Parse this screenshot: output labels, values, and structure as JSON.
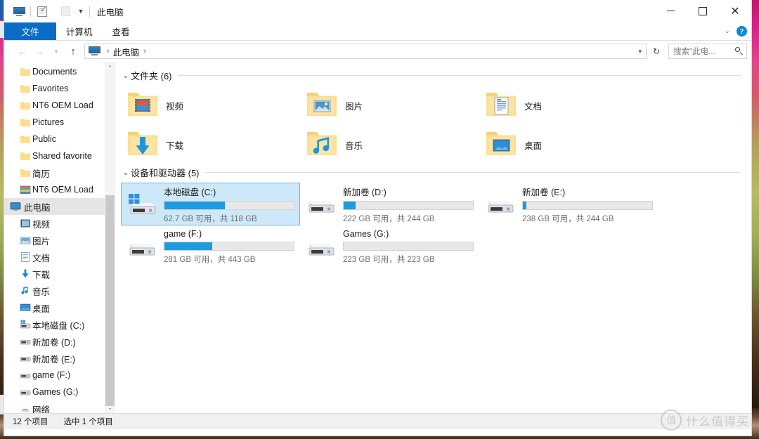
{
  "window": {
    "title": "此电脑",
    "quick_access": [
      "monitor-icon",
      "properties-icon",
      "blank-icon"
    ],
    "controls": {
      "minimize": "—",
      "maximize": "□",
      "close": "✕"
    }
  },
  "ribbon": {
    "tabs": [
      {
        "label": "文件",
        "active_file": true
      },
      {
        "label": "计算机",
        "active_file": false
      },
      {
        "label": "查看",
        "active_file": false
      }
    ],
    "collapse_icon": "chevron-down-icon",
    "help_label": "?"
  },
  "address_bar": {
    "back": "←",
    "forward": "→",
    "history": "▾",
    "up": "↑",
    "crumb_icon": "this-pc-icon",
    "crumb_label": "此电脑",
    "crumb_sep": "›",
    "crumb_sep_lead": "›",
    "dropdown": "▾",
    "refresh": "↻"
  },
  "search": {
    "placeholder": "搜索\"此电...",
    "icon": "search-icon"
  },
  "nav_pane": {
    "items": [
      {
        "label": "Documents",
        "icon": "folder-icon",
        "level": "child",
        "selected": false
      },
      {
        "label": "Favorites",
        "icon": "folder-icon",
        "level": "child",
        "selected": false
      },
      {
        "label": "NT6 OEM Load",
        "icon": "folder-icon",
        "level": "child",
        "selected": false
      },
      {
        "label": "Pictures",
        "icon": "folder-icon",
        "level": "child",
        "selected": false
      },
      {
        "label": "Public",
        "icon": "folder-icon",
        "level": "child",
        "selected": false
      },
      {
        "label": "Shared favorite",
        "icon": "folder-icon",
        "level": "child",
        "selected": false
      },
      {
        "label": "简历",
        "icon": "folder-icon",
        "level": "child",
        "selected": false
      },
      {
        "label": "NT6 OEM Load",
        "icon": "library-icon",
        "level": "child",
        "selected": false
      },
      {
        "label": "此电脑",
        "icon": "this-pc-icon",
        "level": "root",
        "selected": true
      },
      {
        "label": "视频",
        "icon": "video-icon",
        "level": "child",
        "selected": false
      },
      {
        "label": "图片",
        "icon": "pictures-icon",
        "level": "child",
        "selected": false
      },
      {
        "label": "文档",
        "icon": "documents-icon",
        "level": "child",
        "selected": false
      },
      {
        "label": "下载",
        "icon": "download-icon",
        "level": "child",
        "selected": false
      },
      {
        "label": "音乐",
        "icon": "music-icon",
        "level": "child",
        "selected": false
      },
      {
        "label": "桌面",
        "icon": "desktop-icon",
        "level": "child",
        "selected": false
      },
      {
        "label": "本地磁盘 (C:)",
        "icon": "windows-drive-icon",
        "level": "child",
        "selected": false
      },
      {
        "label": "新加卷 (D:)",
        "icon": "drive-icon",
        "level": "child",
        "selected": false
      },
      {
        "label": "新加卷 (E:)",
        "icon": "drive-icon",
        "level": "child",
        "selected": false
      },
      {
        "label": "game (F:)",
        "icon": "drive-icon",
        "level": "child",
        "selected": false
      },
      {
        "label": "Games (G:)",
        "icon": "drive-icon",
        "level": "child",
        "selected": false
      },
      {
        "label": "网络",
        "icon": "network-icon",
        "level": "child",
        "selected": false
      }
    ],
    "scroll_up": "⌃",
    "scroll_down": "⌄"
  },
  "groups": [
    {
      "chevron": "⌄",
      "title": "文件夹 (6)",
      "kind": "folders",
      "items": [
        {
          "name": "视频",
          "icon": "folder-video-icon"
        },
        {
          "name": "图片",
          "icon": "folder-pictures-icon"
        },
        {
          "name": "文档",
          "icon": "folder-documents-icon"
        },
        {
          "name": "下载",
          "icon": "folder-download-icon"
        },
        {
          "name": "音乐",
          "icon": "folder-music-icon"
        },
        {
          "name": "桌面",
          "icon": "folder-desktop-icon"
        }
      ]
    },
    {
      "chevron": "⌄",
      "title": "设备和驱动器 (5)",
      "kind": "drives",
      "items": [
        {
          "name": "本地磁盘 (C:)",
          "icon": "windows-drive-icon",
          "free_text": "62.7 GB 可用，共 118 GB",
          "used_pct": 47,
          "selected": true
        },
        {
          "name": "新加卷 (D:)",
          "icon": "drive-icon",
          "free_text": "222 GB 可用，共 244 GB",
          "used_pct": 9,
          "selected": false
        },
        {
          "name": "新加卷 (E:)",
          "icon": "drive-icon",
          "free_text": "238 GB 可用，共 244 GB",
          "used_pct": 2.5,
          "selected": false
        },
        {
          "name": "game (F:)",
          "icon": "drive-icon",
          "free_text": "281 GB 可用，共 443 GB",
          "used_pct": 37,
          "selected": false
        },
        {
          "name": "Games (G:)",
          "icon": "drive-icon",
          "free_text": "223 GB 可用，共 223 GB",
          "used_pct": 0,
          "selected": false
        }
      ]
    }
  ],
  "status_bar": {
    "item_count": "12 个项目",
    "selection": "选中 1 个项目"
  },
  "watermark": {
    "mark": "值",
    "text": "什么值得买"
  },
  "colors": {
    "accent_blue": "#0b6cc4",
    "bar_blue": "#1e9ae0",
    "selection_fill": "#cde8f9",
    "selection_border": "#72b4dd",
    "folder_yellow": "#fcd77f"
  }
}
